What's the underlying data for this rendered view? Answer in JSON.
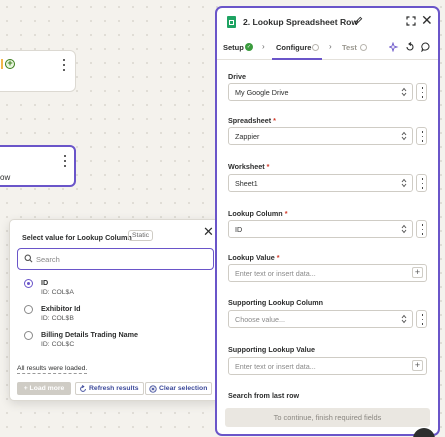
{
  "canvas": {
    "node2_label": "ow"
  },
  "popup": {
    "title": "Select value for Lookup Column",
    "static_label": "Static",
    "search_placeholder": "Search",
    "options": [
      {
        "name": "ID",
        "sub": "ID: COL$A",
        "selected": true
      },
      {
        "name": "Exhibitor Id",
        "sub": "ID: COL$B",
        "selected": false
      },
      {
        "name": "Billing Details Trading Name",
        "sub": "ID: COL$C",
        "selected": false
      }
    ],
    "loaded_note": "All results were loaded.",
    "load_more_label": "Load more",
    "refresh_label": "Refresh results",
    "clear_label": "Clear selection"
  },
  "panel": {
    "step_title": "2. Lookup Spreadsheet Row",
    "tabs": {
      "setup": "Setup",
      "configure": "Configure",
      "test": "Test"
    },
    "fields": {
      "drive": {
        "label": "Drive",
        "value": "My Google Drive"
      },
      "spreadsheet": {
        "label": "Spreadsheet",
        "value": "Zappier"
      },
      "worksheet": {
        "label": "Worksheet",
        "value": "Sheet1"
      },
      "lookup_column": {
        "label": "Lookup Column",
        "value": "ID"
      },
      "lookup_value": {
        "label": "Lookup Value",
        "placeholder": "Enter text or insert data..."
      },
      "supporting_lookup_column": {
        "label": "Supporting Lookup Column",
        "placeholder": "Choose value..."
      },
      "supporting_lookup_value": {
        "label": "Supporting Lookup Value",
        "placeholder": "Enter text or insert data..."
      },
      "search_from_last_row": {
        "label": "Search from last row"
      }
    },
    "required_mark": "*",
    "footer_button": "To continue, finish required fields"
  },
  "colors": {
    "accent": "#6a55c9",
    "success": "#3a9b3d",
    "sheets_green": "#1ea362",
    "required": "#d23a2a"
  }
}
